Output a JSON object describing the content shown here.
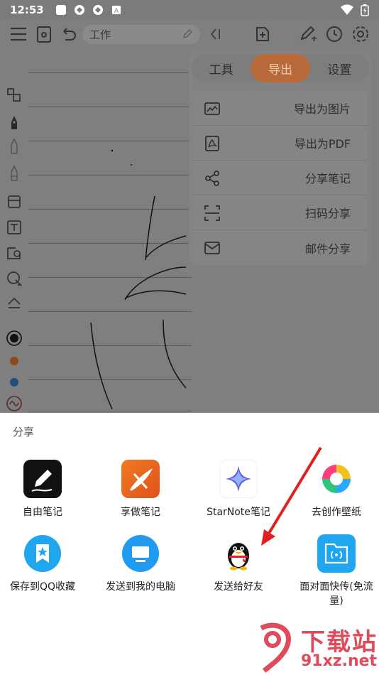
{
  "status_bar": {
    "time": "12:53"
  },
  "toolbar": {
    "title_value": "工作"
  },
  "export_panel": {
    "tabs": [
      {
        "label": "工具",
        "active": false
      },
      {
        "label": "导出",
        "active": true
      },
      {
        "label": "设置",
        "active": false
      }
    ],
    "items": [
      {
        "label": "导出为图片",
        "icon": "image-icon"
      },
      {
        "label": "导出为PDF",
        "icon": "pdf-icon"
      },
      {
        "label": "分享笔记",
        "icon": "share-icon"
      },
      {
        "label": "扫码分享",
        "icon": "scan-icon"
      },
      {
        "label": "邮件分享",
        "icon": "mail-icon"
      }
    ]
  },
  "share_sheet": {
    "title": "分享",
    "apps": [
      {
        "label": "自由笔记",
        "icon": "free-note-app-icon"
      },
      {
        "label": "享做笔记",
        "icon": "xiangzuo-note-app-icon"
      },
      {
        "label": "StarNote笔记",
        "icon": "starnote-app-icon"
      },
      {
        "label": "去创作壁纸",
        "icon": "wallpaper-app-icon"
      },
      {
        "label": "保存到QQ收藏",
        "icon": "qq-favorites-app-icon"
      },
      {
        "label": "发送到我的电脑",
        "icon": "send-to-pc-app-icon"
      },
      {
        "label": "发送给好友",
        "icon": "qq-app-icon"
      },
      {
        "label": "面对面快传(免流量)",
        "icon": "face-to-face-transfer-app-icon"
      }
    ]
  },
  "watermark": {
    "brand": "下载站",
    "url": "91xz.net"
  },
  "colors": {
    "accent": "#e06a2a",
    "dim": "#7f7f7f",
    "arrow": "#e02020"
  }
}
